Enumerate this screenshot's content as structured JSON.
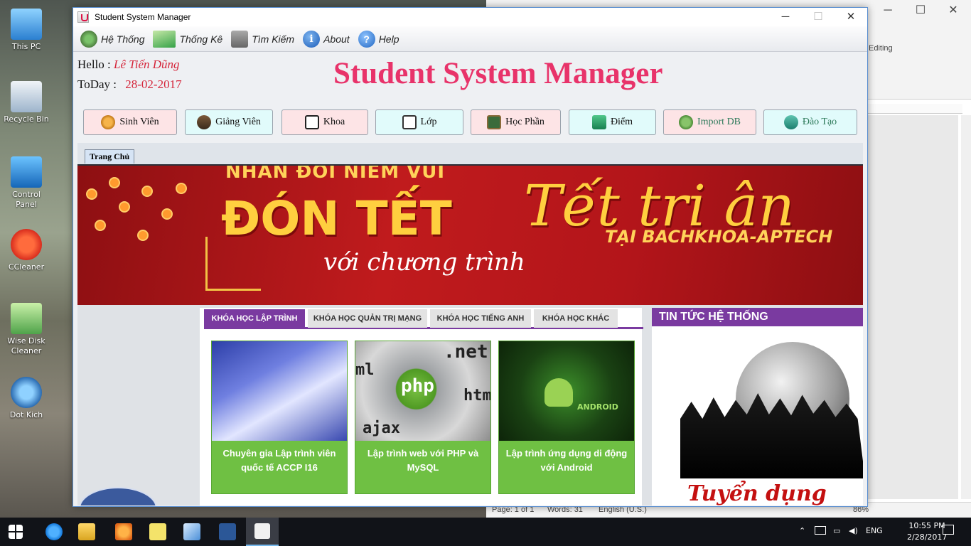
{
  "desktop": {
    "icons": [
      {
        "label": "This PC"
      },
      {
        "label": "Recycle Bin"
      },
      {
        "label": "Control Panel"
      },
      {
        "label": "CCleaner"
      },
      {
        "label": "Wise Disk Cleaner"
      },
      {
        "label": "Dot Kich"
      }
    ]
  },
  "word": {
    "editing_label": "Editing",
    "status_page": "Page: 1 of 1",
    "status_words": "Words: 31",
    "status_lang": "English (U.S.)",
    "zoom": "86%"
  },
  "window": {
    "title": "Student System Manager",
    "minimize": "─",
    "maximize": "☐",
    "close": "✕"
  },
  "menu": {
    "items": [
      {
        "label": "Hệ Thống",
        "icon": "gear-icon"
      },
      {
        "label": "Thống Kê",
        "icon": "chart-icon"
      },
      {
        "label": "Tìm Kiếm",
        "icon": "search-icon"
      },
      {
        "label": "About",
        "icon": "info-icon"
      },
      {
        "label": "Help",
        "icon": "help-icon"
      }
    ]
  },
  "header": {
    "hello_label": "Hello :",
    "user_name": "Lê Tiến Dũng",
    "today_label": "ToDay :",
    "date": "28-02-2017",
    "title": "Student System Manager"
  },
  "nav": {
    "buttons": [
      {
        "label": "Sinh Viên",
        "icon": "student-icon"
      },
      {
        "label": "Giảng Viên",
        "icon": "teachers-icon"
      },
      {
        "label": "Khoa",
        "icon": "book-icon"
      },
      {
        "label": "Lớp",
        "icon": "classroom-icon"
      },
      {
        "label": "Học Phần",
        "icon": "blackboard-icon"
      },
      {
        "label": "Điểm",
        "icon": "grade-icon"
      },
      {
        "label": "Import DB",
        "icon": "database-icon"
      },
      {
        "label": "Đào Tạo",
        "icon": "training-icon"
      }
    ]
  },
  "tabs": {
    "home": "Trang Chủ"
  },
  "banner": {
    "top_line": "NHÂN ĐÔI NIỀM VUI",
    "main": "ĐÓN TẾT",
    "sub": "với chương trình",
    "script": "Tết tri ân",
    "place": "TẠI BACHKHOA-APTECH"
  },
  "courses": {
    "tabs": [
      "KHÓA HỌC LẬP TRÌNH",
      "KHÓA HỌC QUẢN TRỊ MẠNG",
      "KHÓA HỌC TIẾNG ANH",
      "KHÓA HỌC KHÁC"
    ],
    "cards": [
      {
        "title": "Chuyên gia Lập trình viên quốc tế ACCP I16"
      },
      {
        "title": "Lập trình web với PHP và MySQL",
        "thumb_text": [
          "php",
          ".net",
          "html",
          "ajax",
          "ml"
        ]
      },
      {
        "title": "Lập trình ứng dụng di động với Android",
        "thumb_text": [
          "ANDROID"
        ]
      }
    ]
  },
  "news": {
    "heading": "TIN TỨC HỆ THỐNG",
    "image_text": "Tuyển dụng"
  },
  "taskbar": {
    "language": "ENG",
    "time": "10:55 PM",
    "date": "2/28/2017"
  }
}
